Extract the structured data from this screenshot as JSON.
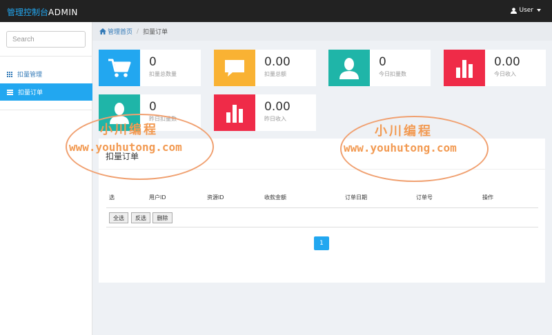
{
  "header": {
    "title_cn": "管理控制台",
    "title_en": "ADMIN",
    "user_label": "User"
  },
  "sidebar": {
    "search_placeholder": "Search",
    "items": [
      {
        "label": "扣量管理",
        "icon": "grid-icon",
        "active": false
      },
      {
        "label": "扣量订单",
        "icon": "list-icon",
        "active": true
      }
    ]
  },
  "breadcrumb": {
    "home": "管理首页",
    "current": "扣量订单"
  },
  "stats": [
    {
      "value": "0",
      "label": "扣量总数量",
      "color": "#22a7f0",
      "icon": "cart-icon"
    },
    {
      "value": "0.00",
      "label": "扣量总额",
      "color": "#f9b233",
      "icon": "comment-icon"
    },
    {
      "value": "0",
      "label": "今日扣量数",
      "color": "#1fb5a8",
      "icon": "user-icon"
    },
    {
      "value": "0.00",
      "label": "今日收入",
      "color": "#ef2b48",
      "icon": "bar-chart-icon"
    },
    {
      "value": "0",
      "label": "昨日扣量数",
      "color": "#1fb5a8",
      "icon": "user-icon"
    },
    {
      "value": "0.00",
      "label": "昨日收入",
      "color": "#ef2b48",
      "icon": "bar-chart-icon"
    }
  ],
  "panel": {
    "title": "扣量订单",
    "columns": [
      "选",
      "用户ID",
      "资源ID",
      "收款金额",
      "订单日期",
      "订单号",
      "操作"
    ],
    "buttons": {
      "select_all": "全选",
      "invert": "反选",
      "delete": "删除"
    },
    "pagination": {
      "current": "1"
    }
  },
  "watermark": {
    "cn": "小川编程",
    "url": "www.youhutong.com"
  }
}
